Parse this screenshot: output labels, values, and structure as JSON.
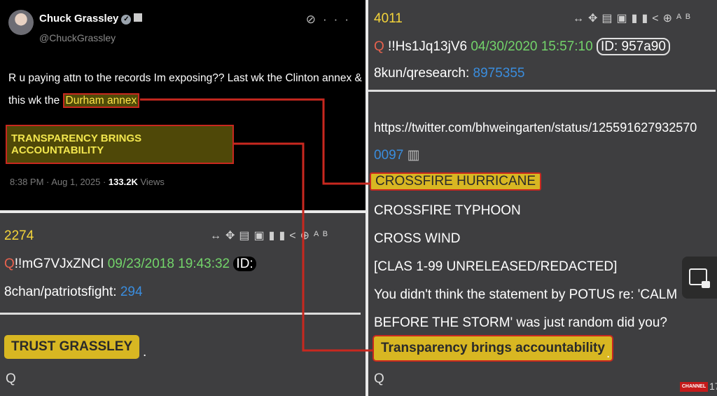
{
  "tweet": {
    "name": "Chuck Grassley",
    "handle": "@ChuckGrassley",
    "icons": [
      "grok-icon",
      "more-icon"
    ],
    "icon_glyphs": "⊘ ···",
    "text_part1": "R u paying attn to the records Im exposing?? Last wk the Clinton annex & this wk the ",
    "text_highlight": "Durham annex",
    "banner": "TRANSPARENCY BRINGS ACCOUNTABILITY",
    "time": "8:38 PM · Aug 1, 2025 · ",
    "views_count": "133.2K",
    "views_label": "Views"
  },
  "post_left": {
    "number": "2274",
    "toolbar_glyphs": "↔✥▤▣▮▮<⊕ᴬᴮ",
    "q_name": "Q",
    "trip": "!!mG7VJxZNCI",
    "date": "09/23/2018 19:43:32",
    "id_label": "ID:",
    "board": "8chan/patriotsfight: ",
    "board_link": "294",
    "trust_text": "TRUST GRASSLEY",
    "trailing": ".",
    "signature": "Q"
  },
  "post_right": {
    "number": "4011",
    "toolbar_glyphs": "↔✥▤▣▮▮<⊕ᴬᴮ",
    "q_name": "Q",
    "trip": " !!Hs1Jq13jV6",
    "date": " 04/30/2020 15:57:10",
    "id_label": "ID: 957a90",
    "board": "8kun/qresearch: ",
    "board_link": "8975355",
    "url_line1": "https://twitter.com/bhweingarten/status/125591627932570",
    "url_line2": "0097",
    "crossfire": "CROSSFIRE HURRICANE",
    "lines": [
      "CROSSFIRE TYPHOON",
      "CROSS WIND",
      "[CLAS 1-99 UNRELEASED/REDACTED]",
      "You didn't think the statement by POTUS re: 'CALM",
      "BEFORE THE STORM' was just random did you?"
    ],
    "transparency": "Transparency brings accountability",
    "trailing": ".",
    "signature": "Q"
  },
  "overlay": {
    "channel_logo": "CHANNEL",
    "channel_num": "17"
  },
  "colors": {
    "highlight_red": "#c8281f",
    "gold": "#d8b722",
    "q_red": "#e8624e",
    "date_green": "#73d46a",
    "link_blue": "#3a8dde",
    "post_number": "#f4d43a"
  }
}
